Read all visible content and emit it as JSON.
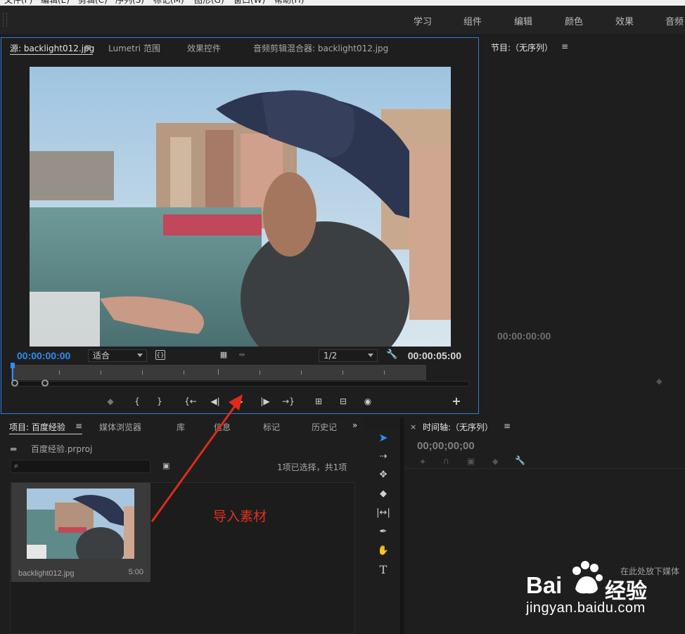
{
  "menubar": {
    "items": [
      "文件(F)",
      "编辑(E)",
      "剪辑(C)",
      "序列(S)",
      "标记(M)",
      "图形(G)",
      "窗口(W)",
      "帮助(H)"
    ]
  },
  "workspaces": {
    "items": [
      "学习",
      "组件",
      "编辑",
      "颜色",
      "效果",
      "音频"
    ]
  },
  "source_panel": {
    "tabs": [
      "源: backlight012.jpg",
      "Lumetri 范围",
      "效果控件",
      "音频剪辑混合器: backlight012.jpg"
    ],
    "current_time": "00:00:00:00",
    "zoom_value": "适合",
    "resolution_value": "1/2",
    "duration": "00:00:05:00",
    "transport_icons": [
      "marker-icon",
      "mark-in-icon",
      "mark-out-icon",
      "go-to-in-icon",
      "step-back-icon",
      "play-icon",
      "step-forward-icon",
      "go-to-out-icon",
      "insert-icon",
      "overwrite-icon",
      "export-frame-icon",
      "add-button-icon"
    ]
  },
  "program_panel": {
    "title": "节目:（无序列）",
    "timecode": "00:00:00:00"
  },
  "project_panel": {
    "tabs": [
      "项目: 百度经验",
      "媒体浏览器",
      "库",
      "信息",
      "标记",
      "历史记"
    ],
    "project_file": "百度经验.prproj",
    "search_placeholder": "",
    "selection_status": "1项已选择，共1项",
    "item_name": "backlight012.jpg",
    "item_duration": "5:00"
  },
  "timeline_panel": {
    "title": "时间轴:（无序列）",
    "timecode": "00;00;00;00",
    "drop_hint": "在此处放下媒体"
  },
  "annotation": {
    "text": "导入素材",
    "color": "#e03020"
  },
  "watermark": {
    "brand_a": "Bai",
    "brand_b": "经验",
    "url": "jingyan.baidu.com"
  },
  "colors": {
    "accent": "#2e8ef0",
    "panel_border_active": "#2d7ed9",
    "background": "#1d1d1d"
  }
}
